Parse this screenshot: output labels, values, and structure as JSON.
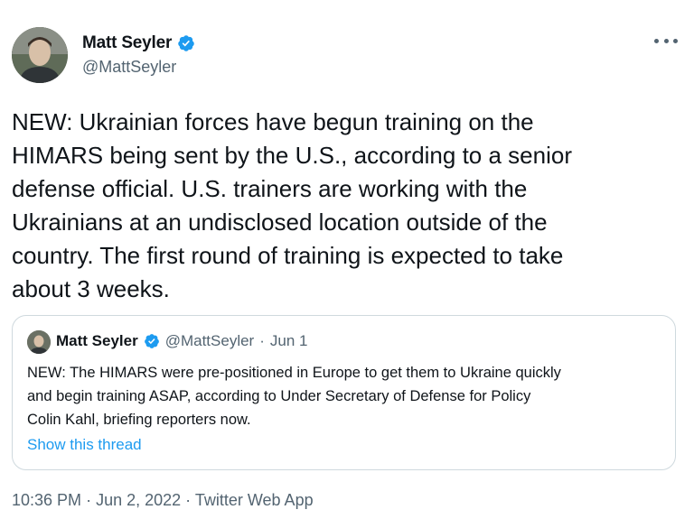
{
  "author": {
    "display_name": "Matt Seyler",
    "handle": "@MattSeyler",
    "verified_icon": "verified-badge-icon",
    "more_icon": "more-options-icon"
  },
  "tweet": {
    "text": "NEW: Ukrainian forces have begun training on the\nHIMARS being sent by the U.S., according to a senior\ndefense official. U.S. trainers are working with the\nUkrainians at an undisclosed location outside of the\ncountry. The first round of training is expected to take\nabout 3 weeks."
  },
  "quoted_tweet": {
    "display_name": "Matt Seyler",
    "handle": "@MattSeyler",
    "separator": "·",
    "date": "Jun 1",
    "text": "NEW: The HIMARS were pre-positioned in Europe to get them to Ukraine quickly\nand begin training ASAP, according to Under Secretary of Defense for Policy\nColin Kahl, briefing reporters now.",
    "show_thread_label": "Show this thread"
  },
  "footer": {
    "time": "10:36 PM",
    "separator1": "·",
    "date": "Jun 2, 2022",
    "separator2": "·",
    "source": "Twitter Web App"
  },
  "colors": {
    "text": "#0f1419",
    "secondary": "#536471",
    "link": "#1d9bf0",
    "border": "#cfd9de",
    "verified": "#1d9bf0"
  }
}
